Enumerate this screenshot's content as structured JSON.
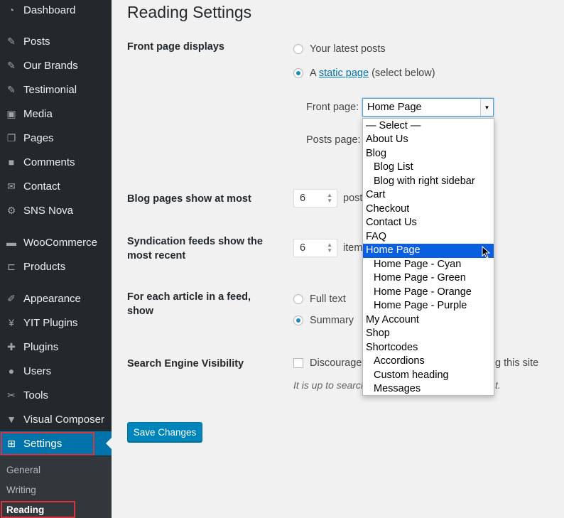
{
  "sidebar": {
    "items": [
      {
        "label": "Dashboard",
        "icon": "dashboard-icon",
        "glyph": "◔"
      },
      {
        "label": "Posts",
        "icon": "pushpin-icon",
        "glyph": "✎"
      },
      {
        "label": "Our Brands",
        "icon": "pushpin-icon",
        "glyph": "✎"
      },
      {
        "label": "Testimonial",
        "icon": "pushpin-icon",
        "glyph": "✎"
      },
      {
        "label": "Media",
        "icon": "media-icon",
        "glyph": "▣"
      },
      {
        "label": "Pages",
        "icon": "pages-icon",
        "glyph": "❐"
      },
      {
        "label": "Comments",
        "icon": "comments-icon",
        "glyph": "■"
      },
      {
        "label": "Contact",
        "icon": "envelope-icon",
        "glyph": "✉"
      },
      {
        "label": "SNS Nova",
        "icon": "gear-icon",
        "glyph": "⚙"
      },
      {
        "label": "WooCommerce",
        "icon": "woocommerce-icon",
        "glyph": "▬"
      },
      {
        "label": "Products",
        "icon": "products-icon",
        "glyph": "⊏"
      },
      {
        "label": "Appearance",
        "icon": "paintbrush-icon",
        "glyph": "✐"
      },
      {
        "label": "YIT Plugins",
        "icon": "yit-icon",
        "glyph": "¥"
      },
      {
        "label": "Plugins",
        "icon": "plugin-icon",
        "glyph": "✚"
      },
      {
        "label": "Users",
        "icon": "user-icon",
        "glyph": "●"
      },
      {
        "label": "Tools",
        "icon": "wrench-icon",
        "glyph": "✂"
      },
      {
        "label": "Visual Composer",
        "icon": "visual-composer-icon",
        "glyph": "▼"
      },
      {
        "label": "Settings",
        "icon": "settings-icon",
        "glyph": "⊞"
      }
    ],
    "submenu": [
      {
        "label": "General"
      },
      {
        "label": "Writing"
      },
      {
        "label": "Reading"
      }
    ]
  },
  "page": {
    "title": "Reading Settings",
    "front_page_displays": {
      "label": "Front page displays",
      "option_latest": "Your latest posts",
      "option_static_prefix": "A ",
      "option_static_link": "static page",
      "option_static_suffix": " (select below)",
      "front_page_label": "Front page:",
      "front_page_value": "Home Page",
      "posts_page_label": "Posts page:"
    },
    "blog_pages": {
      "label": "Blog pages show at most",
      "value": "6",
      "suffix": "post"
    },
    "syndication": {
      "label": "Syndication feeds show the most recent",
      "value": "6",
      "suffix": "item"
    },
    "feed_article": {
      "label": "For each article in a feed, show",
      "option_full": "Full text",
      "option_summary": "Summary"
    },
    "search_engine": {
      "label": "Search Engine Visibility",
      "checkbox_left": "Discourage",
      "checkbox_right": "g this site",
      "note_left": "It is up to search",
      "note_right": "t."
    },
    "save_label": "Save Changes"
  },
  "dropdown": {
    "options": [
      {
        "label": "— Select —",
        "indent": false
      },
      {
        "label": "About Us",
        "indent": false
      },
      {
        "label": "Blog",
        "indent": false
      },
      {
        "label": "Blog List",
        "indent": true
      },
      {
        "label": "Blog with right sidebar",
        "indent": true
      },
      {
        "label": "Cart",
        "indent": false
      },
      {
        "label": "Checkout",
        "indent": false
      },
      {
        "label": "Contact Us",
        "indent": false
      },
      {
        "label": "FAQ",
        "indent": false
      },
      {
        "label": "Home Page",
        "indent": false,
        "selected": true
      },
      {
        "label": "Home Page - Cyan",
        "indent": true
      },
      {
        "label": "Home Page - Green",
        "indent": true
      },
      {
        "label": "Home Page - Orange",
        "indent": true
      },
      {
        "label": "Home Page - Purple",
        "indent": true
      },
      {
        "label": "My Account",
        "indent": false
      },
      {
        "label": "Shop",
        "indent": false
      },
      {
        "label": "Shortcodes",
        "indent": false
      },
      {
        "label": "Accordions",
        "indent": true
      },
      {
        "label": "Custom heading",
        "indent": true
      },
      {
        "label": "Messages",
        "indent": true
      }
    ]
  },
  "colors": {
    "accent": "#0073aa",
    "sidebar_bg": "#23282d",
    "highlight": "#0a5ee0",
    "annotation_red": "#d9333f"
  }
}
